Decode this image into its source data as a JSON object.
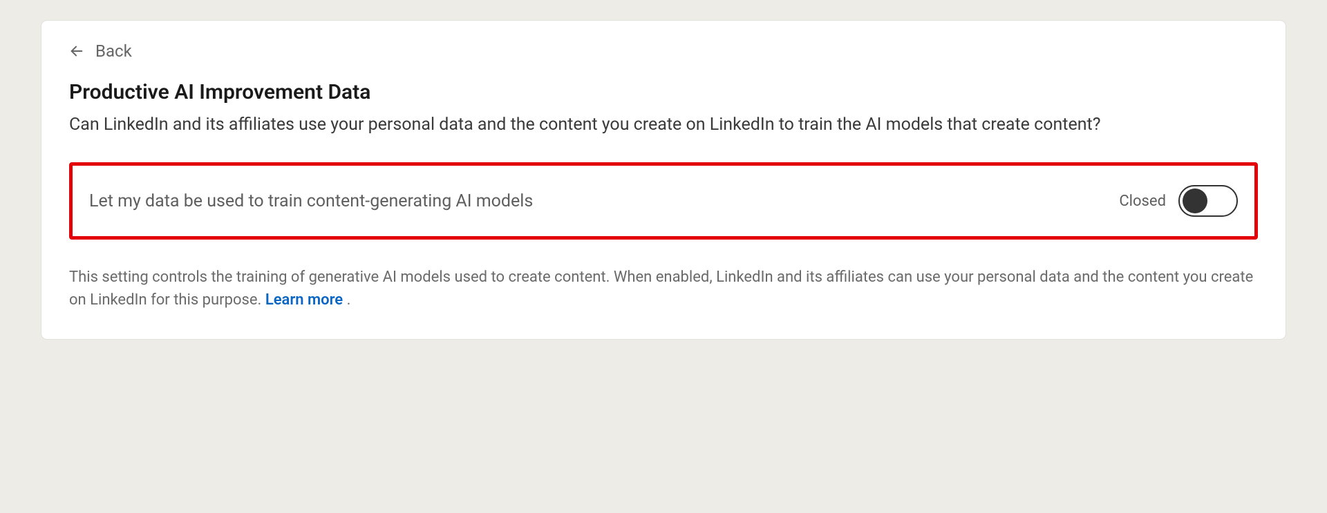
{
  "back": {
    "label": "Back"
  },
  "page": {
    "title": "Productive AI Improvement Data",
    "subtitle": "Can LinkedIn and its affiliates use your personal data and the content you create on LinkedIn to train the AI models that create content?"
  },
  "toggle": {
    "label": "Let my data be used to train content-generating AI models",
    "state": "Closed"
  },
  "help": {
    "text": "This setting controls the training of generative AI models used to create content. When enabled, LinkedIn and its affiliates can use your personal data and the content you create on LinkedIn for this purpose. ",
    "learn_more": "Learn more",
    "period": " ."
  }
}
